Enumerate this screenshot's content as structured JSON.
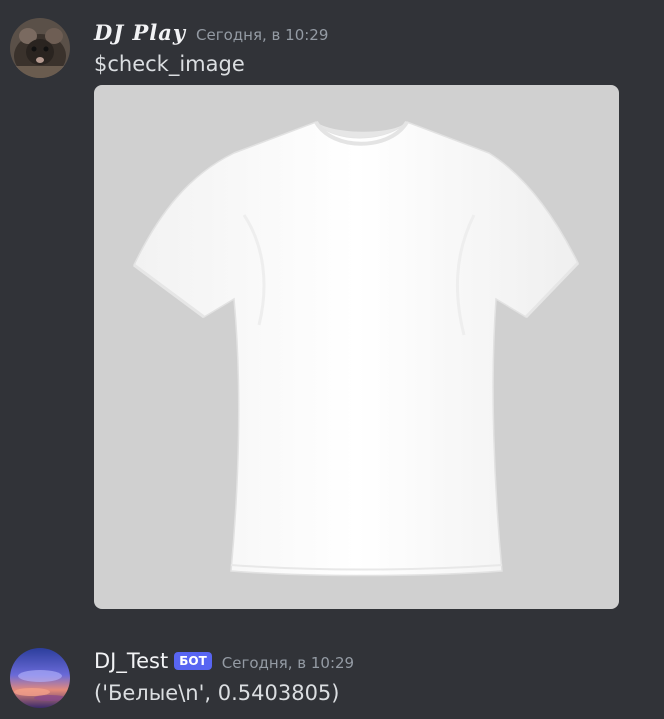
{
  "messages": [
    {
      "username": "DJ Play",
      "timestamp": "Сегодня, в 10:29",
      "content": "$check_image",
      "attachment_icon": "white-tshirt-image"
    },
    {
      "username": "DJ_Test",
      "bot_tag": "БОТ",
      "timestamp": "Сегодня, в 10:29",
      "content": "('Белые\\n', 0.5403805)"
    }
  ],
  "colors": {
    "background": "#313338",
    "bot_tag": "#5865f2",
    "username": "#f2f3f5",
    "timestamp": "#949ba4",
    "text": "#dbdee1"
  }
}
